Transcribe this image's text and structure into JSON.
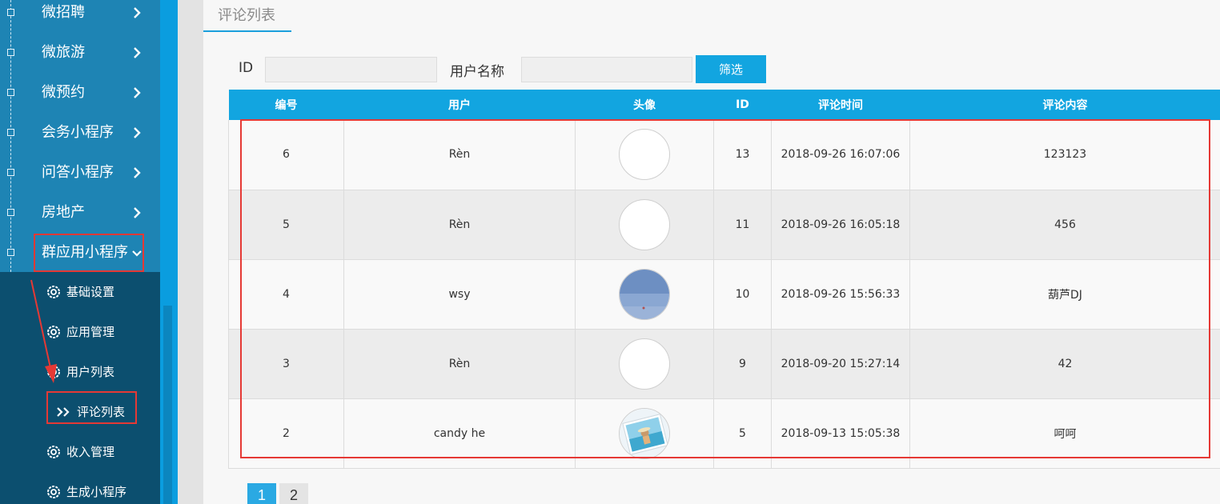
{
  "sidebar": {
    "items": [
      {
        "label": "微招聘"
      },
      {
        "label": "微旅游"
      },
      {
        "label": "微预约"
      },
      {
        "label": "会务小程序"
      },
      {
        "label": "问答小程序"
      },
      {
        "label": "房地产"
      },
      {
        "label": "群应用小程序"
      }
    ],
    "submenu": [
      {
        "label": "基础设置"
      },
      {
        "label": "应用管理"
      },
      {
        "label": "用户列表"
      },
      {
        "label": "评论列表"
      },
      {
        "label": "收入管理"
      },
      {
        "label": "生成小程序"
      }
    ]
  },
  "tab": {
    "label": "评论列表"
  },
  "filter": {
    "id_label": "ID",
    "id_value": "",
    "user_label": "用户名称",
    "user_value": "",
    "button_label": "筛选"
  },
  "table": {
    "headers": [
      "编号",
      "用户",
      "头像",
      "ID",
      "评论时间",
      "评论内容"
    ],
    "rows": [
      {
        "no": "6",
        "user": "Rèn",
        "avatar": "blank",
        "id": "13",
        "time": "2018-09-26 16:07:06",
        "content": "123123"
      },
      {
        "no": "5",
        "user": "Rèn",
        "avatar": "blank",
        "id": "11",
        "time": "2018-09-26 16:05:18",
        "content": "456"
      },
      {
        "no": "4",
        "user": "wsy",
        "avatar": "sea-photo",
        "id": "10",
        "time": "2018-09-26 15:56:33",
        "content": "葫芦DJ"
      },
      {
        "no": "3",
        "user": "Rèn",
        "avatar": "blank",
        "id": "9",
        "time": "2018-09-20 15:27:14",
        "content": "42"
      },
      {
        "no": "2",
        "user": "candy he",
        "avatar": "beach-photo",
        "id": "5",
        "time": "2018-09-13 15:05:38",
        "content": "呵呵"
      }
    ]
  },
  "pagination": {
    "pages": [
      "1",
      "2"
    ],
    "current": "1"
  },
  "colors": {
    "accent": "#12a5e0",
    "sidebar": "#1e84b4",
    "submenu": "#0c4f6f",
    "highlight": "#e53935"
  }
}
